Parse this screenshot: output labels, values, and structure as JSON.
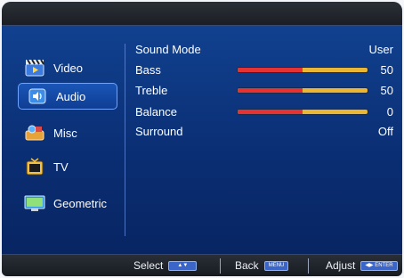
{
  "sidebar": {
    "items": [
      {
        "label": "Video",
        "icon": "film-clapper-icon"
      },
      {
        "label": "Audio",
        "icon": "speaker-icon",
        "selected": true
      },
      {
        "label": "Misc",
        "icon": "misc-toolbox-icon"
      },
      {
        "label": "TV",
        "icon": "tv-icon"
      },
      {
        "label": "Geometric",
        "icon": "monitor-geometry-icon"
      }
    ]
  },
  "settings": {
    "sound_mode": {
      "label": "Sound Mode",
      "value": "User"
    },
    "bass": {
      "label": "Bass",
      "value": "50",
      "level": 0.5
    },
    "treble": {
      "label": "Treble",
      "value": "50",
      "level": 0.5
    },
    "balance": {
      "label": "Balance",
      "value": "0",
      "level": 0.5
    },
    "surround": {
      "label": "Surround",
      "value": "Off"
    }
  },
  "footer": {
    "select": {
      "label": "Select",
      "key_label": "▲▼"
    },
    "back": {
      "label": "Back",
      "key_label": "MENU"
    },
    "adjust": {
      "label": "Adjust",
      "key_label": "◀▶ ENTER"
    }
  },
  "colors": {
    "bar_red": "#e53232",
    "bar_yellow": "#e9b735",
    "accent_border": "#6ea3ff",
    "background": "#0b2a78"
  }
}
